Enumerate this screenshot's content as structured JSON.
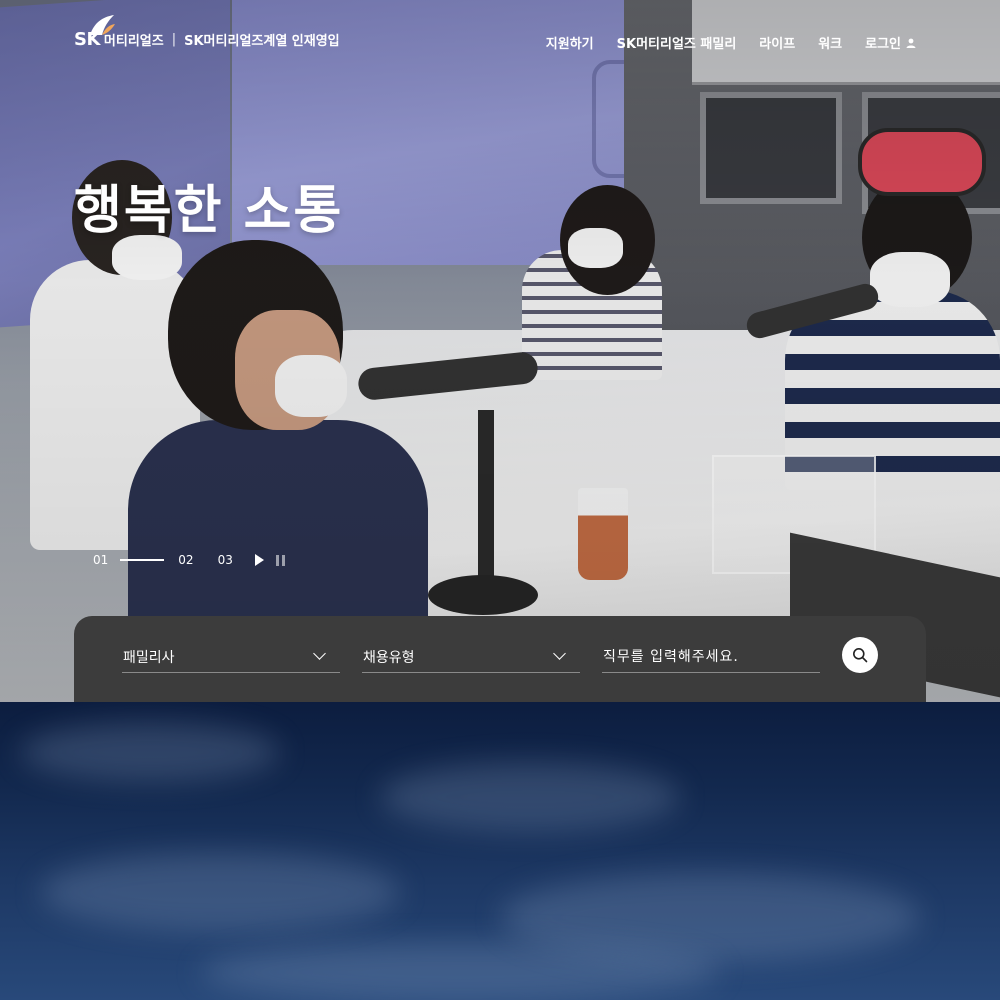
{
  "header": {
    "logo_mark": "SK",
    "company": "머티리얼즈",
    "divider": "|",
    "site_name": "SK머티리얼즈계열 인재영입",
    "nav": [
      {
        "label": "지원하기"
      },
      {
        "label": "SK머티리얼즈 패밀리"
      },
      {
        "label": "라이프"
      },
      {
        "label": "워크"
      },
      {
        "label": "로그인",
        "icon": "user-icon"
      }
    ]
  },
  "hero": {
    "title": "행복한 소통",
    "slides": [
      "01",
      "02",
      "03"
    ],
    "active_slide": 1,
    "controls": {
      "play_icon": "play-icon",
      "pause_icon": "pause-icon"
    }
  },
  "search": {
    "family_label": "패밀리사",
    "employment_type_label": "채용유형",
    "job_placeholder": "직무를 입력해주세요.",
    "job_value": "",
    "button_icon": "search-icon"
  },
  "colors": {
    "panel_bg": "#3c3c3c",
    "text": "#ffffff",
    "sky_top": "#0c1d3f",
    "sky_bottom": "#28497a"
  }
}
